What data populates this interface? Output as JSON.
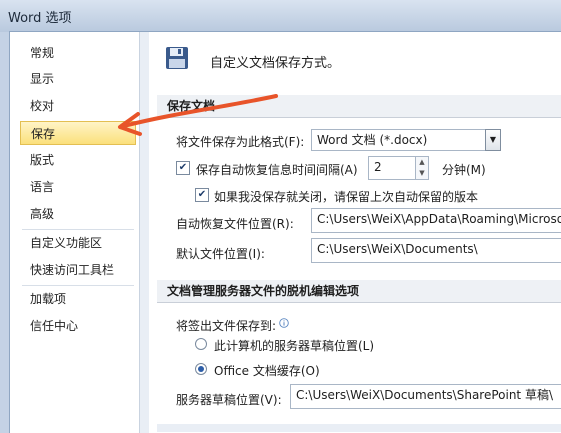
{
  "window": {
    "title": "Word 选项"
  },
  "sidebar": {
    "items": [
      {
        "label": "常规"
      },
      {
        "label": "显示"
      },
      {
        "label": "校对"
      },
      {
        "label": "保存"
      },
      {
        "label": "版式"
      },
      {
        "label": "语言"
      },
      {
        "label": "高级"
      },
      {
        "label": "自定义功能区"
      },
      {
        "label": "快速访问工具栏"
      },
      {
        "label": "加载项"
      },
      {
        "label": "信任中心"
      }
    ],
    "selected": "保存"
  },
  "main": {
    "header_text": "自定义文档保存方式。",
    "save_section": {
      "title": "保存文档",
      "format_label": "将文件保存为此格式(F):",
      "format_value": "Word 文档 (*.docx)",
      "autorecover_label": "保存自动恢复信息时间间隔(A)",
      "autorecover_checked": true,
      "autorecover_minutes": "2",
      "minutes_label": "分钟(M)",
      "keep_last_label": "如果我没保存就关闭，请保留上次自动保留的版本",
      "keep_last_checked": true,
      "autorecover_location_label": "自动恢复文件位置(R):",
      "autorecover_location_value": "C:\\Users\\WeiX\\AppData\\Roaming\\Microso",
      "default_location_label": "默认文件位置(I):",
      "default_location_value": "C:\\Users\\WeiX\\Documents\\"
    },
    "offline_section": {
      "title": "文档管理服务器文件的脱机编辑选项",
      "save_checkout_label": "将签出文件保存到:",
      "option_server": "此计算机的服务器草稿位置(L)",
      "option_cache": "Office 文档缓存(O)",
      "selected_option": "Office 文档缓存(O)",
      "draft_location_label": "服务器草稿位置(V):",
      "draft_location_value": "C:\\Users\\WeiX\\Documents\\SharePoint 草稿\\"
    }
  },
  "colors": {
    "selected_bg": "#fbe07c",
    "arrow": "#e8542a",
    "section_bg": "#eef1f5"
  },
  "icons": [
    "floppy-disk-icon",
    "info-icon",
    "chevron-down-icon",
    "spin-up-icon",
    "spin-down-icon",
    "annotation-arrow"
  ]
}
